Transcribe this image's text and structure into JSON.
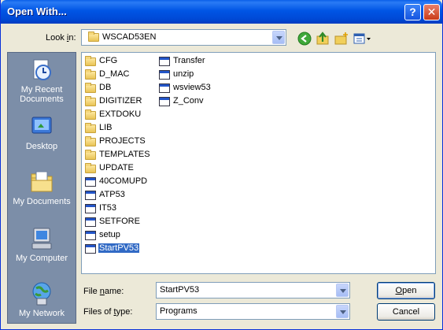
{
  "window": {
    "title": "Open With...",
    "help_label": "?",
    "close_label": "✕"
  },
  "look_in": {
    "label_pre": "Look ",
    "label_key": "i",
    "label_post": "n:",
    "value": "WSCAD53EN"
  },
  "places": [
    {
      "label_line1": "My Recent",
      "label_line2": "Documents",
      "icon": "recent-documents-icon"
    },
    {
      "label_line1": "Desktop",
      "label_line2": "",
      "icon": "desktop-icon"
    },
    {
      "label_line1": "My Documents",
      "label_line2": "",
      "icon": "my-documents-icon"
    },
    {
      "label_line1": "My Computer",
      "label_line2": "",
      "icon": "my-computer-icon"
    },
    {
      "label_line1": "My Network",
      "label_line2": "",
      "icon": "my-network-icon"
    }
  ],
  "files_col1": [
    {
      "name": "CFG",
      "type": "folder"
    },
    {
      "name": "D_MAC",
      "type": "folder"
    },
    {
      "name": "DB",
      "type": "folder"
    },
    {
      "name": "DIGITIZER",
      "type": "folder"
    },
    {
      "name": "EXTDOKU",
      "type": "folder"
    },
    {
      "name": "LIB",
      "type": "folder"
    },
    {
      "name": "PROJECTS",
      "type": "folder"
    },
    {
      "name": "TEMPLATES",
      "type": "folder"
    },
    {
      "name": "UPDATE",
      "type": "folder"
    },
    {
      "name": "40COMUPD",
      "type": "app"
    },
    {
      "name": "ATP53",
      "type": "app"
    },
    {
      "name": "IT53",
      "type": "app"
    },
    {
      "name": "SETFORE",
      "type": "app"
    },
    {
      "name": "setup",
      "type": "app"
    },
    {
      "name": "StartPV53",
      "type": "app",
      "selected": true
    }
  ],
  "files_col2": [
    {
      "name": "Transfer",
      "type": "app"
    },
    {
      "name": "unzip",
      "type": "app"
    },
    {
      "name": "wsview53",
      "type": "app"
    },
    {
      "name": "Z_Conv",
      "type": "app"
    }
  ],
  "file_name": {
    "label_pre": "File ",
    "label_key": "n",
    "label_post": "ame:",
    "value": "StartPV53"
  },
  "file_type": {
    "label_pre": "Files of ",
    "label_key": "t",
    "label_post": "ype:",
    "value": "Programs"
  },
  "buttons": {
    "open_key": "O",
    "open_rest": "pen",
    "cancel": "Cancel"
  }
}
